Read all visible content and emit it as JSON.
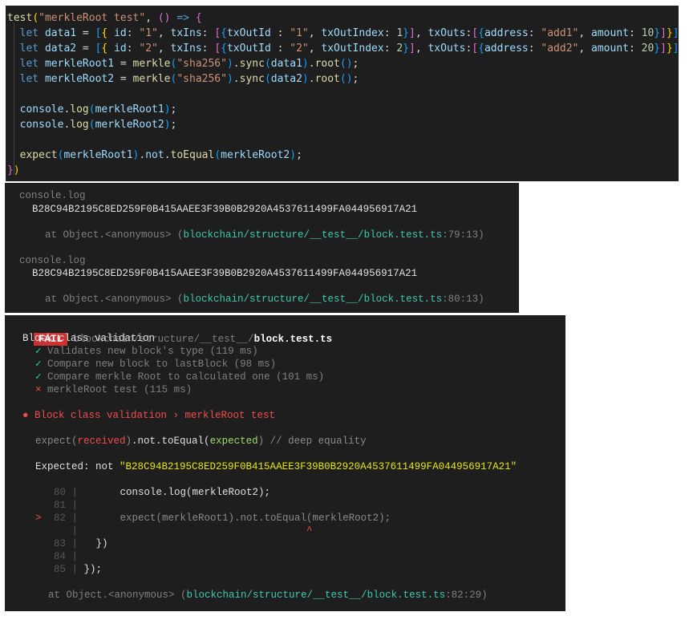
{
  "editor": {
    "lines": [
      [
        [
          "fn",
          "test"
        ],
        [
          "b1",
          "("
        ],
        [
          "str",
          "\"merkleRoot test\""
        ],
        [
          "pn",
          ", "
        ],
        [
          "b2",
          "()"
        ],
        [
          "kw",
          " =>"
        ],
        [
          "pn",
          " "
        ],
        [
          "b2",
          "{"
        ]
      ],
      [
        [
          "pn",
          "  "
        ],
        [
          "kw",
          "let"
        ],
        [
          "vr",
          " data1"
        ],
        [
          "pn",
          " = "
        ],
        [
          "b3",
          "["
        ],
        [
          "b1",
          "{"
        ],
        [
          "vr",
          " id"
        ],
        [
          "pn",
          ": "
        ],
        [
          "str",
          "\"1\""
        ],
        [
          "pn",
          ", "
        ],
        [
          "vr",
          "txIns"
        ],
        [
          "pn",
          ": "
        ],
        [
          "b2",
          "["
        ],
        [
          "b3",
          "{"
        ],
        [
          "vr",
          "txOutId"
        ],
        [
          "pn",
          " : "
        ],
        [
          "str",
          "\"1\""
        ],
        [
          "pn",
          ", "
        ],
        [
          "vr",
          "txOutIndex"
        ],
        [
          "pn",
          ": "
        ],
        [
          "num",
          "1"
        ],
        [
          "b3",
          "}"
        ],
        [
          "b2",
          "]"
        ],
        [
          "pn",
          ", "
        ],
        [
          "vr",
          "txOuts"
        ],
        [
          "pn",
          ":"
        ],
        [
          "b2",
          "["
        ],
        [
          "b3",
          "{"
        ],
        [
          "vr",
          "address"
        ],
        [
          "pn",
          ": "
        ],
        [
          "str",
          "\"add1\""
        ],
        [
          "pn",
          ", "
        ],
        [
          "vr",
          "amount"
        ],
        [
          "pn",
          ": "
        ],
        [
          "num",
          "10"
        ],
        [
          "b3",
          "}"
        ],
        [
          "b2",
          "]"
        ],
        [
          "b1",
          "}"
        ],
        [
          "b3",
          "]"
        ],
        [
          "pn",
          ";"
        ]
      ],
      [
        [
          "pn",
          "  "
        ],
        [
          "kw",
          "let"
        ],
        [
          "vr",
          " data2"
        ],
        [
          "pn",
          " = "
        ],
        [
          "b3",
          "["
        ],
        [
          "b1",
          "{"
        ],
        [
          "vr",
          " id"
        ],
        [
          "pn",
          ": "
        ],
        [
          "str",
          "\"2\""
        ],
        [
          "pn",
          ", "
        ],
        [
          "vr",
          "txIns"
        ],
        [
          "pn",
          ": "
        ],
        [
          "b2",
          "["
        ],
        [
          "b3",
          "{"
        ],
        [
          "vr",
          "txOutId"
        ],
        [
          "pn",
          " : "
        ],
        [
          "str",
          "\"2\""
        ],
        [
          "pn",
          ", "
        ],
        [
          "vr",
          "txOutIndex"
        ],
        [
          "pn",
          ": "
        ],
        [
          "num",
          "2"
        ],
        [
          "b3",
          "}"
        ],
        [
          "b2",
          "]"
        ],
        [
          "pn",
          ", "
        ],
        [
          "vr",
          "txOuts"
        ],
        [
          "pn",
          ":"
        ],
        [
          "b2",
          "["
        ],
        [
          "b3",
          "{"
        ],
        [
          "vr",
          "address"
        ],
        [
          "pn",
          ": "
        ],
        [
          "str",
          "\"add2\""
        ],
        [
          "pn",
          ", "
        ],
        [
          "vr",
          "amount"
        ],
        [
          "pn",
          ": "
        ],
        [
          "num",
          "20"
        ],
        [
          "b3",
          "}"
        ],
        [
          "b2",
          "]"
        ],
        [
          "b1",
          "}"
        ],
        [
          "b3",
          "]"
        ],
        [
          "pn",
          ";"
        ]
      ],
      [
        [
          "pn",
          "  "
        ],
        [
          "kw",
          "let"
        ],
        [
          "vr",
          " merkleRoot1"
        ],
        [
          "pn",
          " = "
        ],
        [
          "fn",
          "merkle"
        ],
        [
          "b3",
          "("
        ],
        [
          "str",
          "\"sha256\""
        ],
        [
          "b3",
          ")"
        ],
        [
          "pn",
          "."
        ],
        [
          "fn",
          "sync"
        ],
        [
          "b3",
          "("
        ],
        [
          "vr",
          "data1"
        ],
        [
          "b3",
          ")"
        ],
        [
          "pn",
          "."
        ],
        [
          "fn",
          "root"
        ],
        [
          "b3",
          "()"
        ],
        [
          "pn",
          ";"
        ]
      ],
      [
        [
          "pn",
          "  "
        ],
        [
          "kw",
          "let"
        ],
        [
          "vr",
          " merkleRoot2"
        ],
        [
          "pn",
          " = "
        ],
        [
          "fn",
          "merkle"
        ],
        [
          "b3",
          "("
        ],
        [
          "str",
          "\"sha256\""
        ],
        [
          "b3",
          ")"
        ],
        [
          "pn",
          "."
        ],
        [
          "fn",
          "sync"
        ],
        [
          "b3",
          "("
        ],
        [
          "vr",
          "data2"
        ],
        [
          "b3",
          ")"
        ],
        [
          "pn",
          "."
        ],
        [
          "fn",
          "root"
        ],
        [
          "b3",
          "()"
        ],
        [
          "pn",
          ";"
        ]
      ],
      [],
      [
        [
          "pn",
          "  "
        ],
        [
          "vr",
          "console"
        ],
        [
          "pn",
          "."
        ],
        [
          "fn",
          "log"
        ],
        [
          "b3",
          "("
        ],
        [
          "vr",
          "merkleRoot1"
        ],
        [
          "b3",
          ")"
        ],
        [
          "pn",
          ";"
        ]
      ],
      [
        [
          "pn",
          "  "
        ],
        [
          "vr",
          "console"
        ],
        [
          "pn",
          "."
        ],
        [
          "fn",
          "log"
        ],
        [
          "b3",
          "("
        ],
        [
          "vr",
          "merkleRoot2"
        ],
        [
          "b3",
          ")"
        ],
        [
          "pn",
          ";"
        ]
      ],
      [],
      [
        [
          "pn",
          "  "
        ],
        [
          "fn",
          "expect"
        ],
        [
          "b3",
          "("
        ],
        [
          "vr",
          "merkleRoot1"
        ],
        [
          "b3",
          ")"
        ],
        [
          "pn",
          "."
        ],
        [
          "vr",
          "not"
        ],
        [
          "pn",
          "."
        ],
        [
          "fn",
          "toEqual"
        ],
        [
          "b3",
          "("
        ],
        [
          "vr",
          "merkleRoot2"
        ],
        [
          "b3",
          ")"
        ],
        [
          "pn",
          ";"
        ]
      ],
      [
        [
          "b2",
          "}"
        ],
        [
          "b1",
          ")"
        ]
      ]
    ]
  },
  "console_output": {
    "entries": [
      {
        "label": "console.log",
        "hash": "B28C94B2195C8ED259F0B415AAEE3F39B0B2920A4537611499FA044956917A21",
        "at": "at Object.<anonymous> (",
        "path": "blockchain/structure/__test__/block.test.ts",
        "loc": ":79:13",
        ")": ")"
      },
      {
        "label": "console.log",
        "hash": "B28C94B2195C8ED259F0B415AAEE3F39B0B2920A4537611499FA044956917A21",
        "at": "at Object.<anonymous> (",
        "path": "blockchain/structure/__test__/block.test.ts",
        "loc": ":80:13"
      }
    ],
    "close_paren": ")"
  },
  "jest": {
    "fail_badge": "FAIL",
    "file_dir": "blockchain/structure/__test__/",
    "file_name": "block.test.ts",
    "suite": "Block class validation",
    "tests": [
      {
        "status": "pass",
        "icon": "✓",
        "name": "Validates new block's type",
        "time": "(119 ms)"
      },
      {
        "status": "pass",
        "icon": "✓",
        "name": "Compare new block to lastBlock",
        "time": "(98 ms)"
      },
      {
        "status": "pass",
        "icon": "✓",
        "name": "Compare merkle Root to calculated one",
        "time": "(101 ms)"
      },
      {
        "status": "fail",
        "icon": "×",
        "name": "merkleRoot test",
        "time": "(115 ms)"
      }
    ],
    "failure_title": "● Block class validation › merkleRoot test",
    "matcher": {
      "expect": "expect(",
      "received": "received",
      ")": ")",
      "not": ".not.toEqual(",
      "expected": "expected",
      "end": ")",
      "comment": " // deep equality"
    },
    "expected_label": "Expected: not ",
    "expected_value": "\"B28C94B2195C8ED259F0B415AAEE3F39B0B2920A4537611499FA044956917A21\"",
    "snippet": [
      {
        "num": "80",
        "code": "      console.log(merkleRoot2);",
        "marker": ""
      },
      {
        "num": "81",
        "code": "",
        "marker": ""
      },
      {
        "num": "82",
        "code": "      expect(merkleRoot1).not.toEqual(merkleRoot2);",
        "marker": ">"
      },
      {
        "num": "",
        "code": "                                     ^",
        "marker": ""
      },
      {
        "num": "83",
        "code": "  })",
        "marker": ""
      },
      {
        "num": "84",
        "code": "",
        "marker": ""
      },
      {
        "num": "85",
        "code": "});",
        "marker": ""
      }
    ],
    "stack_at": "at Object.<anonymous> (",
    "stack_path": "blockchain/structure/__test__/block.test.ts",
    "stack_loc": ":82:29",
    "stack_close": ")"
  },
  "colors": {
    "background": "#1e1e1e",
    "fail_badge": "#cd3131",
    "pass": "#23d18b",
    "fail": "#f14c4c",
    "path": "#3dc9b0",
    "expected_value": "#e5e510"
  }
}
